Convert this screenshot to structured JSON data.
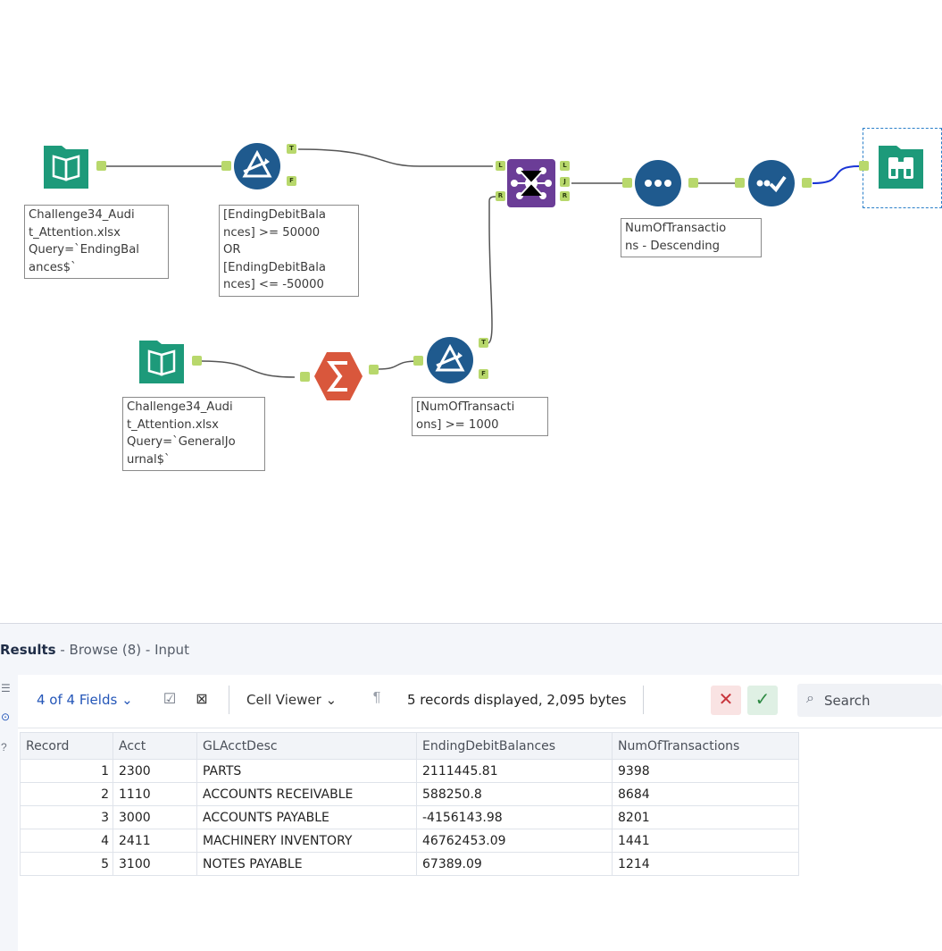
{
  "workflow": {
    "input1": {
      "label": "Challenge34_Audi\nt_Attention.xlsx\nQuery=`EndingBal\nances$`"
    },
    "input2": {
      "label": "Challenge34_Audi\nt_Attention.xlsx\nQuery=`GeneralJo\nurnal$`"
    },
    "filter1": {
      "label": "[EndingDebitBala\nnces] >= 50000\nOR\n[EndingDebitBala\nnces] <= -50000",
      "true_tag": "T",
      "false_tag": "F"
    },
    "filter2": {
      "label": "[NumOfTransacti\nons] >= 1000",
      "true_tag": "T",
      "false_tag": "F"
    },
    "join": {
      "left_tag": "L",
      "right_in_tag": "R",
      "out_l": "L",
      "out_j": "J",
      "out_r": "R"
    },
    "sort": {
      "label": "NumOfTransactio\nns - Descending"
    }
  },
  "results": {
    "title_bold": "Results",
    "title_rest": " - Browse (8) - Input",
    "fields_label": "4 of 4 Fields",
    "cell_viewer_label": "Cell Viewer",
    "records_info": "5 records displayed, 2,095 bytes",
    "search_placeholder": "Search",
    "columns": [
      "Record",
      "Acct",
      "GLAcctDesc",
      "EndingDebitBalances",
      "NumOfTransactions"
    ],
    "rows": [
      [
        "1",
        "2300",
        "PARTS",
        "2111445.81",
        "9398"
      ],
      [
        "2",
        "1110",
        "ACCOUNTS RECEIVABLE",
        "588250.8",
        "8684"
      ],
      [
        "3",
        "3000",
        "ACCOUNTS PAYABLE",
        "-4156143.98",
        "8201"
      ],
      [
        "4",
        "2411",
        "MACHINERY INVENTORY",
        "46762453.09",
        "1441"
      ],
      [
        "5",
        "3100",
        "NOTES PAYABLE",
        "67389.09",
        "1214"
      ]
    ]
  },
  "colors": {
    "input_green": "#1d9a7a",
    "filter_blue": "#1f5a8e",
    "summarize_orange": "#d9573c",
    "join_purple": "#6b3d97",
    "anchor_green": "#b8d86c"
  }
}
